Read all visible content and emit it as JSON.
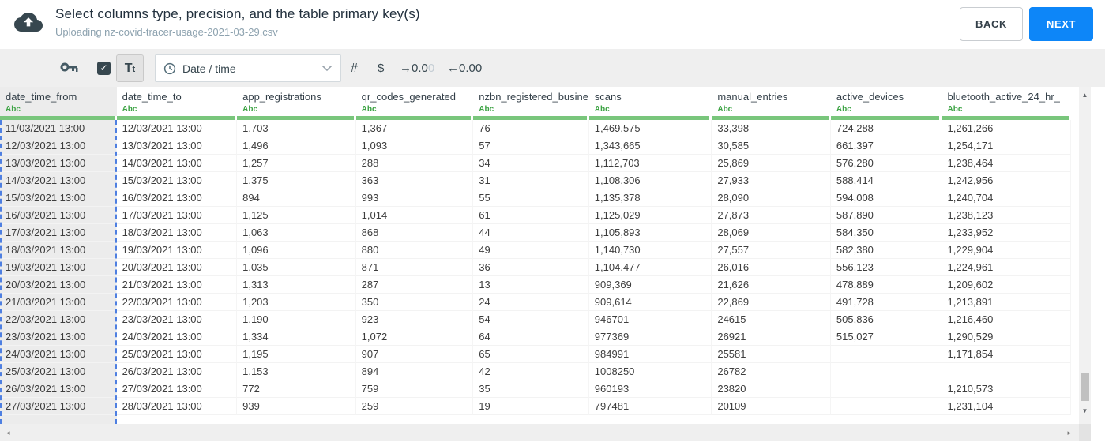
{
  "header": {
    "title": "Select columns type, precision, and the table primary key(s)",
    "subtitle": "Uploading nz-covid-tracer-usage-2021-03-29.csv",
    "back_label": "BACK",
    "next_label": "NEXT"
  },
  "toolbar": {
    "checkbox_checked": true,
    "text_type_label": "Tt",
    "type_select_value": "Date / time",
    "number_label": "#",
    "currency_label": "$",
    "decimal_increase_prefix": "→0.0",
    "decimal_increase_faded": "0",
    "decimal_decrease": "←0.00"
  },
  "icons": {
    "upload": "cloud-upload",
    "primary_key": "key",
    "checkbox_check": "✓",
    "type_clock": "clock",
    "chevron_down": "chevron-down",
    "scroll_up": "▲",
    "scroll_down": "▼",
    "scroll_left": "◂",
    "scroll_right": "▸"
  },
  "colors": {
    "accent_blue": "#0d86f8",
    "type_green": "#3da344",
    "column_underline_green": "#79c67c",
    "selection_dash_blue": "#4e7fe1"
  },
  "table": {
    "selected_column_index": 0,
    "columns": [
      {
        "name": "date_time_from",
        "type": "Abc"
      },
      {
        "name": "date_time_to",
        "type": "Abc"
      },
      {
        "name": "app_registrations",
        "type": "Abc"
      },
      {
        "name": "qr_codes_generated",
        "type": "Abc"
      },
      {
        "name": "nzbn_registered_busine",
        "type": "Abc"
      },
      {
        "name": "scans",
        "type": "Abc"
      },
      {
        "name": "manual_entries",
        "type": "Abc"
      },
      {
        "name": "active_devices",
        "type": "Abc"
      },
      {
        "name": "bluetooth_active_24_hr_",
        "type": "Abc"
      }
    ],
    "rows": [
      [
        "11/03/2021 13:00",
        "12/03/2021 13:00",
        "1,703",
        "1,367",
        "76",
        "1,469,575",
        "33,398",
        "724,288",
        "1,261,266"
      ],
      [
        "12/03/2021 13:00",
        "13/03/2021 13:00",
        "1,496",
        "1,093",
        "57",
        "1,343,665",
        "30,585",
        "661,397",
        "1,254,171"
      ],
      [
        "13/03/2021 13:00",
        "14/03/2021 13:00",
        "1,257",
        "288",
        "34",
        "1,112,703",
        "25,869",
        "576,280",
        "1,238,464"
      ],
      [
        "14/03/2021 13:00",
        "15/03/2021 13:00",
        "1,375",
        "363",
        "31",
        "1,108,306",
        "27,933",
        "588,414",
        "1,242,956"
      ],
      [
        "15/03/2021 13:00",
        "16/03/2021 13:00",
        "894",
        "993",
        "55",
        "1,135,378",
        "28,090",
        "594,008",
        "1,240,704"
      ],
      [
        "16/03/2021 13:00",
        "17/03/2021 13:00",
        "1,125",
        "1,014",
        "61",
        "1,125,029",
        "27,873",
        "587,890",
        "1,238,123"
      ],
      [
        "17/03/2021 13:00",
        "18/03/2021 13:00",
        "1,063",
        "868",
        "44",
        "1,105,893",
        "28,069",
        "584,350",
        "1,233,952"
      ],
      [
        "18/03/2021 13:00",
        "19/03/2021 13:00",
        "1,096",
        "880",
        "49",
        "1,140,730",
        "27,557",
        "582,380",
        "1,229,904"
      ],
      [
        "19/03/2021 13:00",
        "20/03/2021 13:00",
        "1,035",
        "871",
        "36",
        "1,104,477",
        "26,016",
        "556,123",
        "1,224,961"
      ],
      [
        "20/03/2021 13:00",
        "21/03/2021 13:00",
        "1,313",
        "287",
        "13",
        "909,369",
        "21,626",
        "478,889",
        "1,209,602"
      ],
      [
        "21/03/2021 13:00",
        "22/03/2021 13:00",
        "1,203",
        "350",
        "24",
        "909,614",
        "22,869",
        "491,728",
        "1,213,891"
      ],
      [
        "22/03/2021 13:00",
        "23/03/2021 13:00",
        "1,190",
        "923",
        "54",
        "946701",
        "24615",
        "505,836",
        "1,216,460"
      ],
      [
        "23/03/2021 13:00",
        "24/03/2021 13:00",
        "1,334",
        "1,072",
        "64",
        "977369",
        "26921",
        "515,027",
        "1,290,529"
      ],
      [
        "24/03/2021 13:00",
        "25/03/2021 13:00",
        "1,195",
        "907",
        "65",
        "984991",
        "25581",
        "",
        "1,171,854"
      ],
      [
        "25/03/2021 13:00",
        "26/03/2021 13:00",
        "1,153",
        "894",
        "42",
        "1008250",
        "26782",
        "",
        ""
      ],
      [
        "26/03/2021 13:00",
        "27/03/2021 13:00",
        "772",
        "759",
        "35",
        "960193",
        "23820",
        "",
        "1,210,573"
      ],
      [
        "27/03/2021 13:00",
        "28/03/2021 13:00",
        "939",
        "259",
        "19",
        "797481",
        "20109",
        "",
        "1,231,104"
      ]
    ]
  }
}
